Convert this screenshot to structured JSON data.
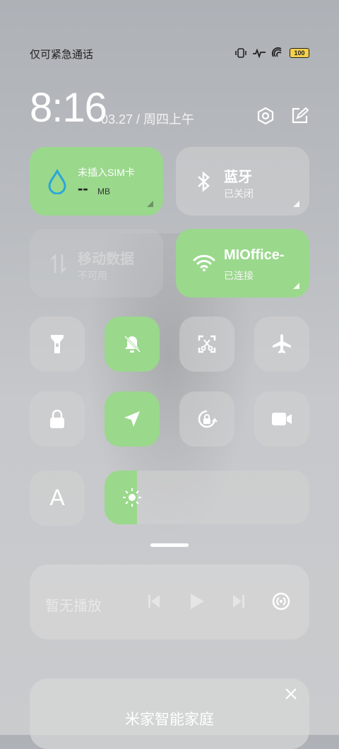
{
  "status": {
    "carrier_text": "仅可紧急通话",
    "battery_level": "100",
    "icons": [
      "vibrate-icon",
      "activity-icon",
      "hotspot-icon",
      "battery-icon"
    ]
  },
  "header": {
    "time": "8:16",
    "date": "03.27 / 周四上午",
    "icons": [
      "settings-icon",
      "edit-icon"
    ]
  },
  "tiles": {
    "data_usage": {
      "title": "未插入SIM卡",
      "value": "--",
      "unit": "MB",
      "state": "on"
    },
    "bluetooth": {
      "title": "蓝牙",
      "subtitle": "已关闭",
      "state": "off"
    },
    "mobile_data": {
      "title": "移动数据",
      "subtitle": "不可用",
      "state": "disabled"
    },
    "wifi": {
      "title": "MIOffice-",
      "subtitle": "已连接",
      "state": "on"
    }
  },
  "toggles": [
    {
      "name": "flashlight",
      "icon": "flashlight-icon",
      "state": "off"
    },
    {
      "name": "mute",
      "icon": "bell-off-icon",
      "state": "on"
    },
    {
      "name": "screenshot",
      "icon": "screenshot-icon",
      "state": "off"
    },
    {
      "name": "airplane",
      "icon": "airplane-icon",
      "state": "off"
    },
    {
      "name": "lock-screen",
      "icon": "lock-icon",
      "state": "off"
    },
    {
      "name": "location",
      "icon": "location-icon",
      "state": "on"
    },
    {
      "name": "auto-rotate",
      "icon": "rotation-lock-icon",
      "state": "off"
    },
    {
      "name": "screen-record",
      "icon": "video-icon",
      "state": "off"
    }
  ],
  "brightness": {
    "font_label": "A",
    "level_fraction": 0.16,
    "accent": "#9ad88c"
  },
  "media": {
    "label": "暂无播放"
  },
  "smart_home": {
    "title": "米家智能家庭"
  },
  "colors": {
    "accent": "#9ad88c",
    "tile_off": "#d2d2d2"
  }
}
